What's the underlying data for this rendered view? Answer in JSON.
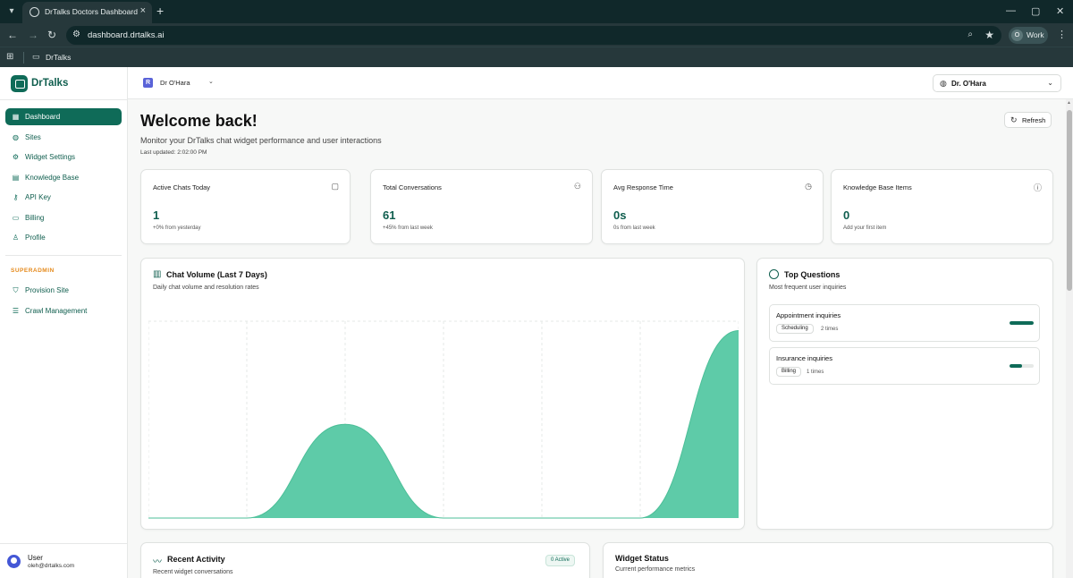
{
  "browser": {
    "tab_title": "DrTalks Doctors Dashboard",
    "url": "dashboard.drtalks.ai",
    "profile_label": "Work",
    "profile_initial": "O",
    "bookmark_folder": "DrTalks"
  },
  "sidebar": {
    "brand": "DrTalks",
    "items": [
      {
        "label": "Dashboard",
        "icon": "grid-icon",
        "active": true
      },
      {
        "label": "Sites",
        "icon": "globe-icon"
      },
      {
        "label": "Widget Settings",
        "icon": "gear-icon"
      },
      {
        "label": "Knowledge Base",
        "icon": "book-icon"
      },
      {
        "label": "API Key",
        "icon": "key-icon"
      },
      {
        "label": "Billing",
        "icon": "card-icon"
      },
      {
        "label": "Profile",
        "icon": "user-icon"
      }
    ],
    "superadmin_heading": "SUPERADMIN",
    "admin_items": [
      {
        "label": "Provision Site",
        "icon": "shield-icon"
      },
      {
        "label": "Crawl Management",
        "icon": "database-icon"
      }
    ],
    "user": {
      "name": "User",
      "email": "oleh@drtalks.com"
    }
  },
  "topbar": {
    "site_initial": "R",
    "site_name": "Dr O'Hara",
    "doctor_select": "Dr. O'Hara"
  },
  "header": {
    "title": "Welcome back!",
    "subtitle": "Monitor your DrTalks chat widget performance and user interactions",
    "last_updated": "Last updated: 2:02:00 PM",
    "refresh_label": "Refresh"
  },
  "stats": [
    {
      "title": "Active Chats Today",
      "value": "1",
      "sub": "+0% from yesterday",
      "icon": "message-icon"
    },
    {
      "title": "Total Conversations",
      "value": "61",
      "sub": "+45% from last week",
      "icon": "users-icon"
    },
    {
      "title": "Avg Response Time",
      "value": "0s",
      "sub": "0s from last week",
      "icon": "clock-icon"
    },
    {
      "title": "Knowledge Base Items",
      "value": "0",
      "sub": "Add your first item",
      "icon": "info-icon"
    }
  ],
  "chat_volume": {
    "title": "Chat Volume (Last 7 Days)",
    "subtitle": "Daily chat volume and resolution rates"
  },
  "chart_data": {
    "type": "area",
    "x": [
      0,
      1,
      2,
      3,
      4,
      5,
      6
    ],
    "values": [
      0,
      0,
      1,
      0,
      0,
      0,
      2
    ],
    "ylim": [
      0,
      2.1
    ],
    "grid": true,
    "color": "#5ecba8"
  },
  "top_questions": {
    "title": "Top Questions",
    "subtitle": "Most frequent user inquiries",
    "items": [
      {
        "question": "Appointment inquiries",
        "tag": "Scheduling",
        "count": "2 times",
        "share": 1.0
      },
      {
        "question": "Insurance inquiries",
        "tag": "Billing",
        "count": "1 times",
        "share": 0.5
      }
    ]
  },
  "recent_activity": {
    "title": "Recent Activity",
    "subtitle": "Recent widget conversations",
    "badge": "0 Active"
  },
  "widget_status": {
    "title": "Widget Status",
    "subtitle": "Current performance metrics"
  },
  "colors": {
    "brand": "#0f6b58",
    "accent": "#5ecba8",
    "superadmin": "#e58a1c"
  }
}
